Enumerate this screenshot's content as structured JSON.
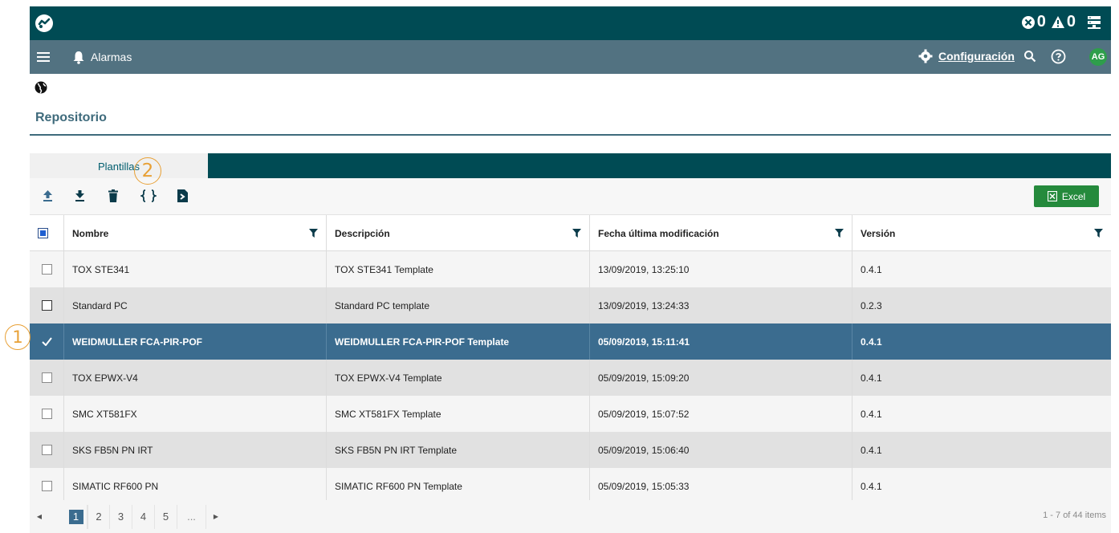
{
  "topbar": {
    "error_count": "0",
    "warning_count": "0"
  },
  "navbar": {
    "title": "Alarmas",
    "config_label": "Configuración",
    "avatar_initials": "AG"
  },
  "page": {
    "title": "Repositorio"
  },
  "tabs": [
    {
      "label": "Plantillas",
      "active": true
    }
  ],
  "toolbar": {
    "excel_label": "Excel"
  },
  "table": {
    "columns": [
      "Nombre",
      "Descripción",
      "Fecha última modificación",
      "Versión"
    ],
    "rows": [
      {
        "nombre": "TOX STE341",
        "descripcion": "TOX STE341 Template",
        "fecha": "13/09/2019, 13:25:10",
        "version": "0.4.1",
        "selected": false
      },
      {
        "nombre": "Standard PC",
        "descripcion": "Standard PC template",
        "fecha": "13/09/2019, 13:24:33",
        "version": "0.2.3",
        "selected": false
      },
      {
        "nombre": "WEIDMULLER FCA-PIR-POF",
        "descripcion": "WEIDMULLER FCA-PIR-POF Template",
        "fecha": "05/09/2019, 15:11:41",
        "version": "0.4.1",
        "selected": true
      },
      {
        "nombre": "TOX EPWX-V4",
        "descripcion": "TOX EPWX-V4 Template",
        "fecha": "05/09/2019, 15:09:20",
        "version": "0.4.1",
        "selected": false
      },
      {
        "nombre": "SMC XT581FX",
        "descripcion": "SMC XT581FX Template",
        "fecha": "05/09/2019, 15:07:52",
        "version": "0.4.1",
        "selected": false
      },
      {
        "nombre": "SKS FB5N PN IRT",
        "descripcion": "SKS FB5N PN IRT Template",
        "fecha": "05/09/2019, 15:06:40",
        "version": "0.4.1",
        "selected": false
      },
      {
        "nombre": "SIMATIC RF600 PN",
        "descripcion": "SIMATIC RF600 PN Template",
        "fecha": "05/09/2019, 15:05:33",
        "version": "0.4.1",
        "selected": false
      }
    ]
  },
  "pager": {
    "pages": [
      "1",
      "2",
      "3",
      "4",
      "5"
    ],
    "current": "1",
    "ellipsis": "...",
    "summary": "1 - 7 of 44 items"
  },
  "callouts": [
    "1",
    "2"
  ],
  "colors": {
    "topbar": "#004b54",
    "navbar": "#527281",
    "selected_row": "#3b6c8f",
    "excel": "#258a3c",
    "callout": "#e8a035"
  }
}
